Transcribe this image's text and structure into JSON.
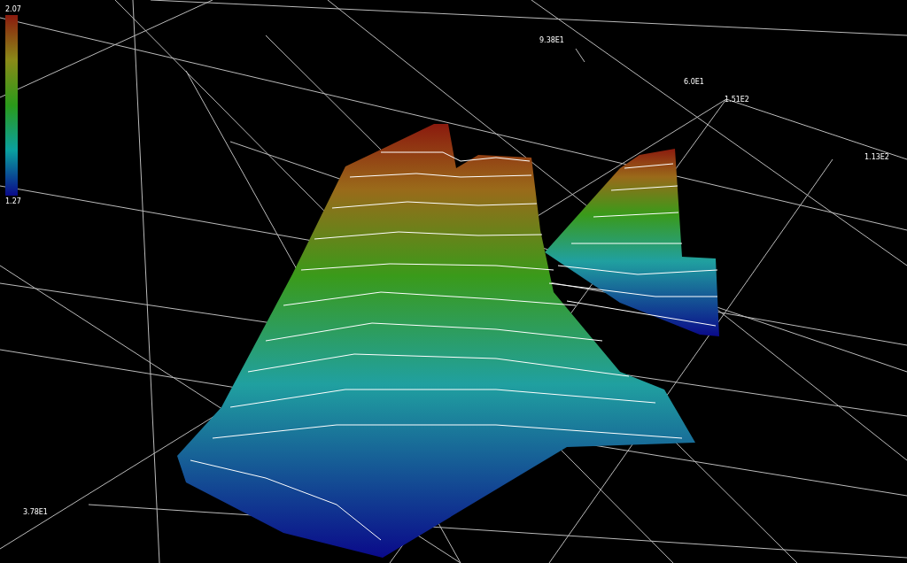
{
  "color_scale": {
    "max": "2.07",
    "min": "1.27"
  },
  "axis_labels": [
    "9.38E1",
    "6.0E1",
    "1.51E2",
    "1.13E2",
    "3.78E1"
  ]
}
